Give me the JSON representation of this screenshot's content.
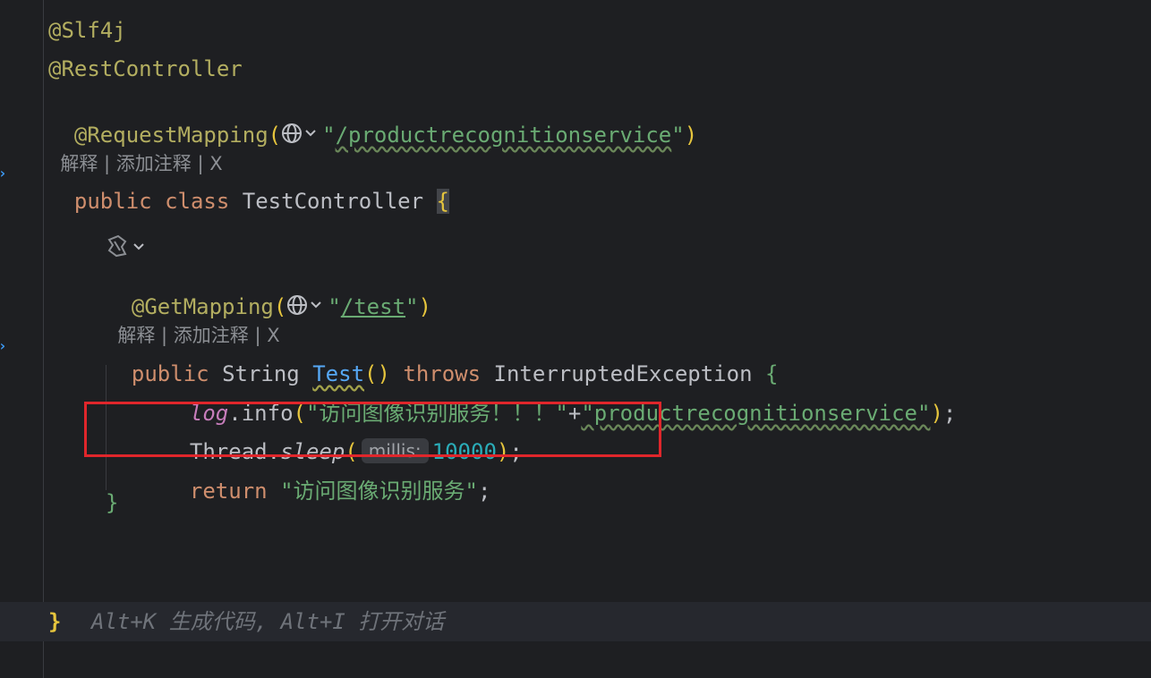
{
  "colors": {
    "background": "#1e1f22",
    "annotation": "#b3ae60",
    "keyword": "#cf8e6d",
    "string": "#6aab73",
    "method": "#56a8f5",
    "number": "#2aacb8",
    "field": "#c77dbb",
    "highlight_box": "#e0262b"
  },
  "code": {
    "l1": {
      "text": "@Slf4j"
    },
    "l2": {
      "text": "@RestController"
    },
    "l3": {
      "ann": "@RequestMapping",
      "open": "(",
      "q1": "\"",
      "path": "/productrecognitionservice",
      "q2": "\"",
      "close": ")"
    },
    "hint1": {
      "explain": "解释",
      "sep1": " | ",
      "add": "添加注释",
      "sep2": " | ",
      "close": "X"
    },
    "l4": {
      "kw1": "public",
      "kw2": "class",
      "name": "TestController",
      "brace": "{"
    },
    "l5": {
      "ann": "@GetMapping",
      "open": "(",
      "q1": "\"",
      "path": "/test",
      "q2": "\"",
      "close": ")"
    },
    "hint2": {
      "explain": "解释",
      "sep1": " | ",
      "add": "添加注释",
      "sep2": " | ",
      "close": "X"
    },
    "l6": {
      "kw1": "public",
      "type": "String",
      "method": "Test",
      "parens": "()",
      "throws": "throws",
      "exc": "InterruptedException",
      "brace": "{"
    },
    "l7": {
      "obj": "log",
      "dot": ".",
      "call": "info",
      "open": "(",
      "s1": "\"访问图像识别服务！！！\"",
      "plus": "+",
      "s2": "\"productrecognitionservice\"",
      "close": ")",
      "semi": ";"
    },
    "l8": {
      "obj": "Thread",
      "dot": ".",
      "call": "sleep",
      "open": "(",
      "hint": "millis:",
      "num": "10000",
      "close": ")",
      "semi": ";"
    },
    "l9": {
      "kw": "return",
      "str": "\"访问图像识别服务\"",
      "semi": ";"
    },
    "l10": {
      "brace": "}"
    },
    "l11": {
      "brace": "}"
    },
    "ai_hint": "Alt+K 生成代码, Alt+I 打开对话"
  },
  "icons": [
    "globe-icon",
    "chevron-down-icon",
    "spring-bean-icon",
    "fold-arrow-icon"
  ]
}
